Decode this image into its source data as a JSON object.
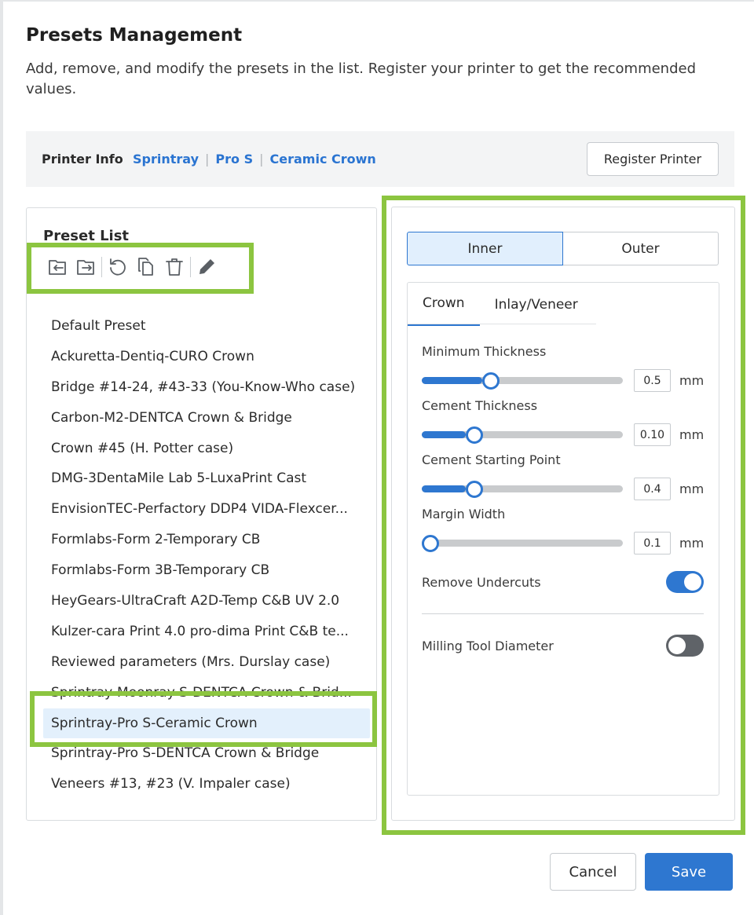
{
  "dialog": {
    "title": "Presets Management",
    "description": "Add, remove, and modify the presets in the list. Register your printer to get the recommended values."
  },
  "printer_info": {
    "label": "Printer Info",
    "brand": "Sprintray",
    "model": "Pro S",
    "material": "Ceramic Crown",
    "register_label": "Register Printer"
  },
  "preset_list": {
    "title": "Preset List",
    "toolbar": [
      "import-icon",
      "export-icon",
      "reset-icon",
      "duplicate-icon",
      "delete-icon",
      "edit-icon"
    ],
    "items": [
      "Default Preset",
      "Ackuretta-Dentiq-CURO Crown",
      "Bridge #14-24, #43-33 (You-Know-Who case)",
      "Carbon-M2-DENTCA Crown & Bridge",
      "Crown #45 (H. Potter case)",
      "DMG-3DentaMile Lab 5-LuxaPrint Cast",
      "EnvisionTEC-Perfactory DDP4 VIDA-Flexcer...",
      "Formlabs-Form 2-Temporary CB",
      "Formlabs-Form 3B-Temporary CB",
      "HeyGears-UltraCraft A2D-Temp C&B UV 2.0",
      "Kulzer-cara Print 4.0 pro-dima Print C&B te...",
      "Reviewed parameters (Mrs. Durslay case)",
      "Sprintray-Moonray S-DENTCA Crown & Brid...",
      "Sprintray-Pro S-Ceramic Crown",
      "Sprintray-Pro S-DENTCA Crown & Bridge",
      "Veneers #13, #23 (V. Impaler case)"
    ],
    "selected_index": 13
  },
  "settings": {
    "segments": [
      "Inner",
      "Outer"
    ],
    "active_segment": "Inner",
    "tabs": [
      "Crown",
      "Inlay/Veneer"
    ],
    "active_tab": "Crown",
    "fields": [
      {
        "label": "Minimum Thickness",
        "value": "0.5",
        "unit": "mm",
        "fraction": 0.3
      },
      {
        "label": "Cement Thickness",
        "value": "0.10",
        "unit": "mm",
        "fraction": 0.22
      },
      {
        "label": "Cement Starting Point",
        "value": "0.4",
        "unit": "mm",
        "fraction": 0.22
      },
      {
        "label": "Margin Width",
        "value": "0.1",
        "unit": "mm",
        "fraction": 0.0
      }
    ],
    "remove_undercuts": {
      "label": "Remove Undercuts",
      "on": true
    },
    "milling_tool": {
      "label": "Milling Tool Diameter",
      "on": false
    }
  },
  "footer": {
    "cancel_label": "Cancel",
    "save_label": "Save"
  },
  "colors": {
    "accent": "#2e77d0",
    "highlight": "#8cc540",
    "selected_row": "#e3f0fc"
  }
}
